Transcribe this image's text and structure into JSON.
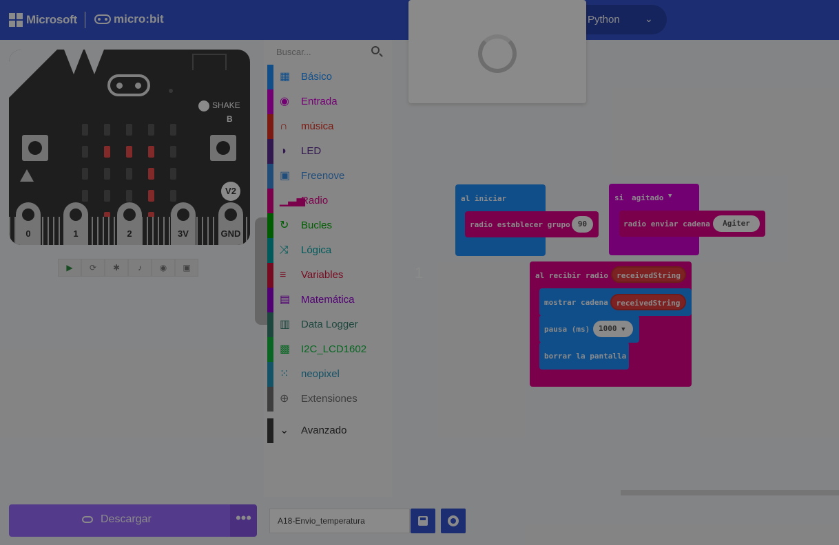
{
  "header": {
    "brand": "Microsoft",
    "product": "micro:bit",
    "language_mode": "Python"
  },
  "simulator": {
    "shake_label": "SHAKE",
    "button_b_label": "B",
    "version_badge": "V2",
    "pins": [
      "0",
      "1",
      "2",
      "3V",
      "GND"
    ],
    "led_matrix": [
      [
        0,
        0,
        0,
        0,
        0
      ],
      [
        0,
        1,
        1,
        1,
        0
      ],
      [
        0,
        0,
        0,
        1,
        0
      ],
      [
        0,
        0,
        0,
        1,
        0
      ],
      [
        0,
        1,
        1,
        1,
        0
      ]
    ],
    "controls": [
      "play-icon",
      "restart-icon",
      "debug-icon",
      "sound-icon",
      "screenshot-icon",
      "fullscreen-icon"
    ]
  },
  "toolbox": {
    "search_placeholder": "Buscar...",
    "categories": [
      {
        "label": "Básico",
        "color": "#1e90ff",
        "icon": "grid-icon"
      },
      {
        "label": "Entrada",
        "color": "#d400d4",
        "icon": "target-icon"
      },
      {
        "label": "música",
        "color": "#e63022",
        "icon": "headphones-icon"
      },
      {
        "label": "LED",
        "color": "#5c2d91",
        "icon": "toggle-icon"
      },
      {
        "label": "Freenove",
        "color": "#3c8de0",
        "icon": "chip-icon"
      },
      {
        "label": "Radio",
        "color": "#e3008c",
        "icon": "signal-icon"
      },
      {
        "label": "Bucles",
        "color": "#00aa00",
        "icon": "loop-icon"
      },
      {
        "label": "Lógica",
        "color": "#00a4a6",
        "icon": "shuffle-icon"
      },
      {
        "label": "Variables",
        "color": "#dc143c",
        "icon": "lines-icon"
      },
      {
        "label": "Matemática",
        "color": "#9400d3",
        "icon": "calculator-icon"
      },
      {
        "label": "Data Logger",
        "color": "#378273",
        "icon": "table-icon"
      },
      {
        "label": "I2C_LCD1602",
        "color": "#0fbd3f",
        "icon": "lcd-icon"
      },
      {
        "label": "neopixel",
        "color": "#2699bf",
        "icon": "ring-dots-icon"
      },
      {
        "label": "Extensiones",
        "color": "#717171",
        "icon": "plus-circle-icon"
      }
    ],
    "advanced": {
      "label": "Avanzado",
      "color": "#3c3c3c"
    }
  },
  "workspace": {
    "marker": "1",
    "blocks": {
      "on_start": {
        "label": "al iniciar",
        "child": "radio establecer grupo",
        "value": "90"
      },
      "on_shake": {
        "label": "si",
        "event": "agitado",
        "child": "radio enviar cadena",
        "value": "Agiter"
      },
      "on_receive": {
        "label": "al recibir radio",
        "param": "receivedString",
        "show": {
          "label": "mostrar cadena",
          "value": "receivedString"
        },
        "pause": {
          "label": "pausa (ms)",
          "value": "1000"
        },
        "clear": {
          "label": "borrar la pantalla"
        }
      }
    }
  },
  "bottom": {
    "download_label": "Descargar",
    "more_label": "•••",
    "project_name": "A18-Envio_temperatura"
  },
  "colors": {
    "brand": "#3454d1",
    "download": "#9c6bff",
    "radio": "#e3008c",
    "basic": "#1e90ff",
    "variable": "#dc143c"
  }
}
